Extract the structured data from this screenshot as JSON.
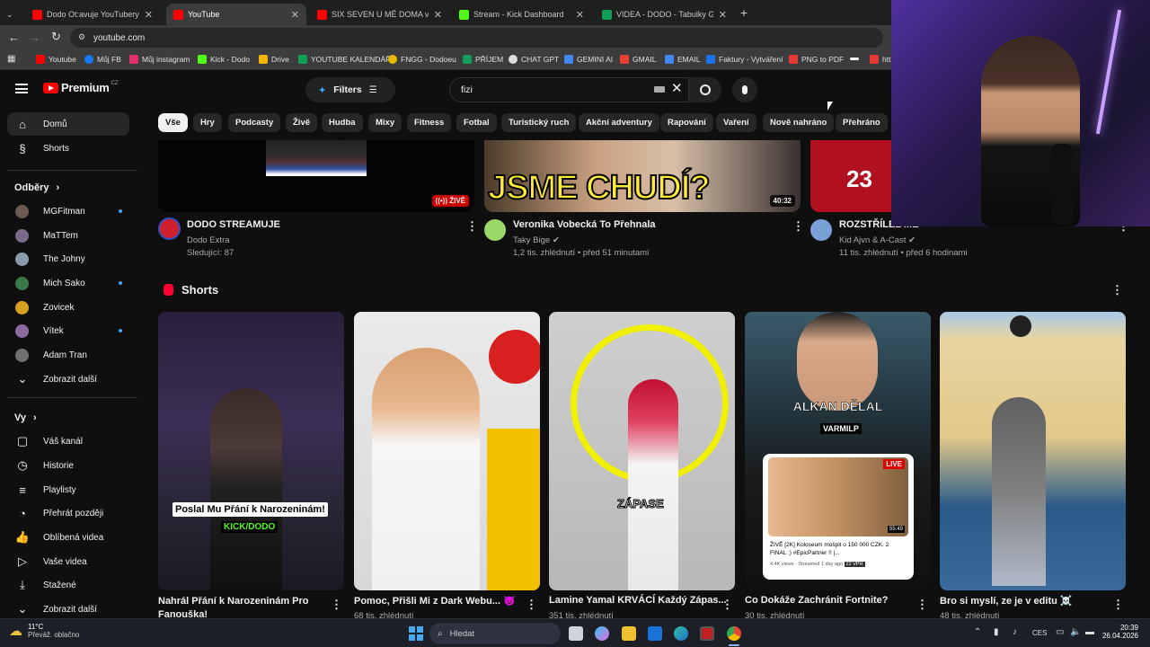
{
  "browser": {
    "tabs": [
      {
        "title": "Dodo Ot:avuje YouTubery - Yo",
        "color": "#ff0000"
      },
      {
        "title": "YouTube",
        "color": "#ff0000",
        "active": true
      },
      {
        "title": "SIX SEVEN U MĚ DOMA v realn",
        "color": "#ff0000"
      },
      {
        "title": "Stream - Kick Dashboard",
        "color": "#53fc18"
      },
      {
        "title": "VIDEA - DODO - Tabulky Googl",
        "color": "#0f9d58"
      }
    ],
    "new_tab": "+",
    "url": "youtube.com",
    "bookmarks": [
      "Youtube",
      "Můj FB",
      "Můj instagram",
      "Kick - Dodo",
      "Drive",
      "YOUTUBE KALENDÁŘ",
      "FNGG - Dodoeu",
      "PŘÍJEM",
      "CHAT GPT",
      "GEMINI AI",
      "GMAIL",
      "EMAIL",
      "Faktury - Vytváření",
      "PNG to PDF",
      "",
      "htt"
    ]
  },
  "youtube": {
    "logo_text": "Premium",
    "logo_region": "CZ",
    "filters_label": "Filters",
    "search_value": "fizi",
    "chips": [
      "Vše",
      "Hry",
      "Podcasty",
      "Živě",
      "Hudba",
      "Mixy",
      "Fitness",
      "Fotbal",
      "Turistický ruch",
      "Akční adventury",
      "Rapování",
      "Vaření",
      "Nově nahráno",
      "Přehráno"
    ],
    "sidebar": {
      "home": "Domů",
      "shorts": "Shorts",
      "subscriptions_header": "Odběry",
      "subscriptions": [
        {
          "name": "MGFitman",
          "dot": true,
          "color": "#6a5a50"
        },
        {
          "name": "MaTTem",
          "dot": false,
          "color": "#7a6a8a"
        },
        {
          "name": "The Johny",
          "dot": false,
          "color": "#8a9aaa"
        },
        {
          "name": "Mich Sako",
          "dot": true,
          "color": "#3a7a4a"
        },
        {
          "name": "Zovicek",
          "dot": false,
          "color": "#d8a020"
        },
        {
          "name": "Vítek",
          "dot": true,
          "color": "#8a6aa0"
        },
        {
          "name": "Adam Tran",
          "dot": false,
          "color": "#707070"
        }
      ],
      "show_more": "Zobrazit další",
      "you_header": "Vy",
      "you_items": [
        "Váš kanál",
        "Historie",
        "Playlisty",
        "Přehrát později",
        "Oblíbená videa",
        "Vaše videa",
        "Stažené",
        "Zobrazit další"
      ]
    },
    "videos": [
      {
        "title": "DODO STREAMUJE",
        "channel": "Dodo Extra",
        "meta": "Sledující: 87",
        "badge": "ŽIVĚ"
      },
      {
        "title": "Veronika Vobecká To Přehnala",
        "channel": "Taky Bige",
        "meta": "1,2 tis. zhlédnutí • před 51 minutami",
        "duration": "40:32",
        "thumb_text": "JSME CHUDÍ?"
      },
      {
        "title": "ROZSTŘÍLEL MĚ",
        "channel": "Kid Ajvn & A-Cast",
        "meta": "11 tis. zhlédnutí • před 6 hodinami",
        "thumb_text": "23"
      }
    ],
    "shorts_header": "Shorts",
    "shorts": [
      {
        "title": "Nahrál Přání k Narozeninám Pro Fanouška!",
        "meta": "",
        "overlay": "Poslal Mu Přání k Narozeninám!",
        "overlay2": "KICK/DODO"
      },
      {
        "title": "Pomoc, Přišli Mi z Dark Webu... 😈",
        "meta": "68 tis. zhlédnutí"
      },
      {
        "title": "Lamine Yamal KRVÁCÍ Každý Zápas...",
        "meta": "351 tis. zhlédnutí",
        "overlay": "ZÁPASE"
      },
      {
        "title": "Co Dokáže Zachránit Fortnite?",
        "meta": "30 tis. zhlédnutí",
        "overlay": "ALKAN DĚLAL",
        "overlay2": "VARMILP",
        "live": "LIVE",
        "card_title": "ŽIVĚ [2K] Koloseum mošpit o 150 000 CZK. 2 FINAL :) #EpicPartner !! |...",
        "card_meta": "4.4K views · Streamed 1 day ago",
        "card_badge": "22 VPH",
        "card_dur": "55:49"
      },
      {
        "title": "Bro si myslí, ze je v editu ☠️",
        "meta": "48 tis. zhlédnutí"
      }
    ]
  },
  "taskbar": {
    "weather_temp": "11°C",
    "weather_desc": "Převáž. oblačno",
    "search": "Hledat",
    "lang": "CES",
    "time": "20:39",
    "date": "26.04.2026"
  }
}
